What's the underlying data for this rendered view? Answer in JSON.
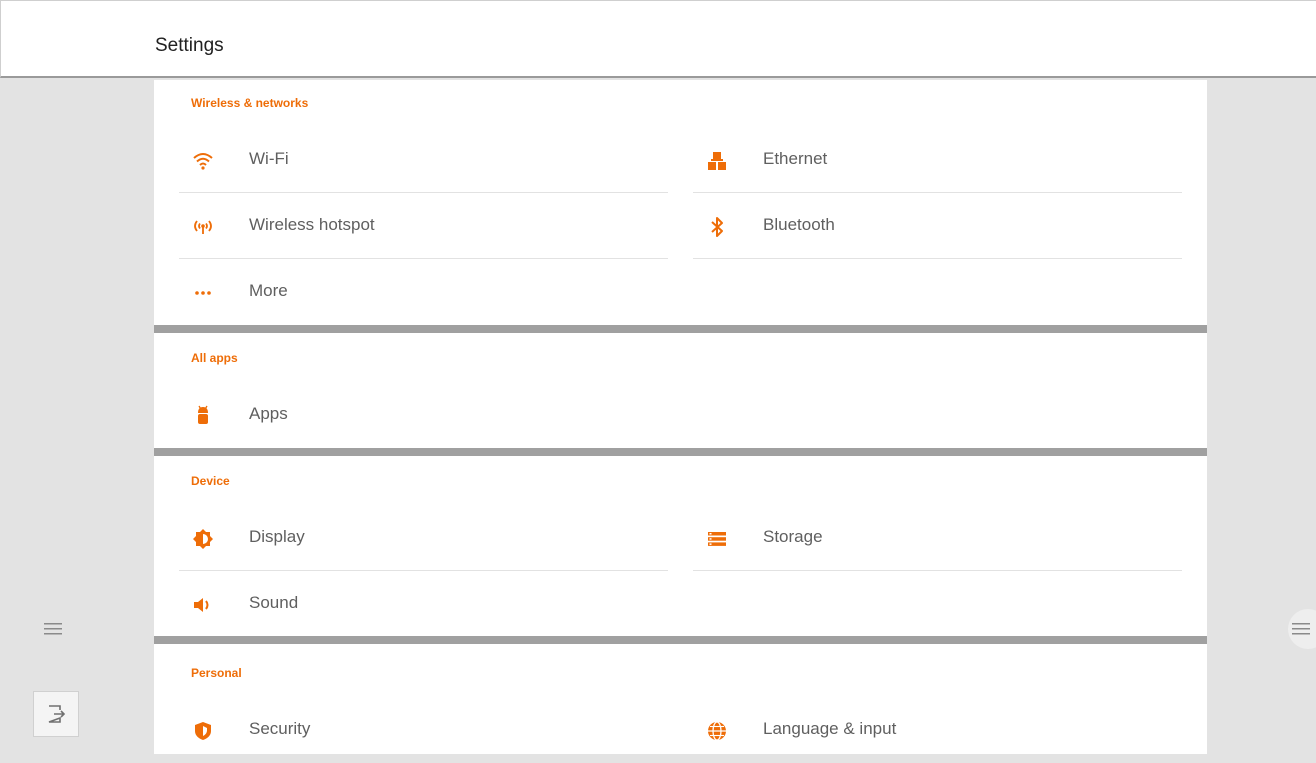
{
  "header": {
    "title": "Settings"
  },
  "sections": {
    "wireless": {
      "title": "Wireless & networks",
      "wifi": "Wi-Fi",
      "ethernet": "Ethernet",
      "hotspot": "Wireless hotspot",
      "bluetooth": "Bluetooth",
      "more": "More"
    },
    "apps": {
      "title": "All apps",
      "apps": "Apps"
    },
    "device": {
      "title": "Device",
      "display": "Display",
      "storage": "Storage",
      "sound": "Sound"
    },
    "personal": {
      "title": "Personal",
      "security": "Security",
      "language": "Language & input"
    }
  },
  "colors": {
    "accent": "#ee6d08",
    "background": "#e3e3e3",
    "separator": "#a0a0a0"
  },
  "icons": {
    "wifi": "wifi-icon",
    "ethernet": "ethernet-icon",
    "hotspot": "hotspot-icon",
    "bluetooth": "bluetooth-icon",
    "more": "more-dots-icon",
    "apps": "android-icon",
    "display": "brightness-icon",
    "storage": "storage-icon",
    "sound": "volume-icon",
    "security": "shield-icon",
    "language": "globe-icon",
    "left_menu": "hamburger-menu-icon",
    "right_menu": "hamburger-menu-icon",
    "exit": "exit-icon"
  }
}
